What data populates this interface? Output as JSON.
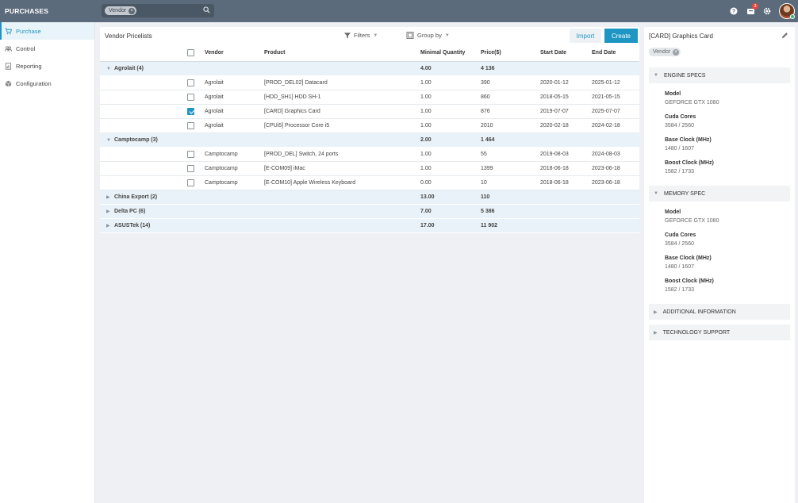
{
  "app": {
    "title": "PURCHASES"
  },
  "search": {
    "facet": "Vendor",
    "placeholder": ""
  },
  "header": {
    "notification_count": "3"
  },
  "sidebar": {
    "items": [
      {
        "label": "Purchase"
      },
      {
        "label": "Control"
      },
      {
        "label": "Reporting"
      },
      {
        "label": "Configuration"
      }
    ]
  },
  "main": {
    "title": "Vendor Pricelists",
    "filters_label": "Filters",
    "groupby_label": "Group by",
    "import_label": "Import",
    "create_label": "Create",
    "columns": [
      "Vendor",
      "Product",
      "Minimal Quantity",
      "Price($)",
      "Start Date",
      "End Date"
    ],
    "groups": [
      {
        "name": "Agrolait (4)",
        "qty": "4.00",
        "price": "4 136",
        "expanded": true,
        "rows": [
          {
            "vendor": "Agrolait",
            "product": "[PROD_DEL02] Datacard",
            "qty": "1.00",
            "price": "390",
            "start": "2020-01-12",
            "end": "2025-01-12",
            "checked": false
          },
          {
            "vendor": "Agrolait",
            "product": "[HDD_SH1] HDD SH-1",
            "qty": "1.00",
            "price": "860",
            "start": "2018-05-15",
            "end": "2021-05-15",
            "checked": false
          },
          {
            "vendor": "Agrolait",
            "product": "[CARD] Graphics Card",
            "qty": "1.00",
            "price": "876",
            "start": "2019-07-07",
            "end": "2025-07-07",
            "checked": true
          },
          {
            "vendor": "Agrolait",
            "product": "[CPUi5] Processor Core i5",
            "qty": "1.00",
            "price": "2010",
            "start": "2020-02-18",
            "end": "2024-02-18",
            "checked": false
          }
        ]
      },
      {
        "name": "Camptocamp (3)",
        "qty": "2.00",
        "price": "1 464",
        "expanded": true,
        "rows": [
          {
            "vendor": "Camptocamp",
            "product": "[PROD_DEL] Switch, 24 ports",
            "qty": "1.00",
            "price": "55",
            "start": "2019-08-03",
            "end": "2024-08-03",
            "checked": false
          },
          {
            "vendor": "Camptocamp",
            "product": "[E-COM09] iMac",
            "qty": "1.00",
            "price": "1399",
            "start": "2018-06-18",
            "end": "2023-06-18",
            "checked": false
          },
          {
            "vendor": "Camptocamp",
            "product": "[E-COM10] Apple Wireless Keyboard",
            "qty": "0.00",
            "price": "10",
            "start": "2018-06-18",
            "end": "2023-06-18",
            "checked": false
          }
        ]
      },
      {
        "name": "China Export (2)",
        "qty": "13.00",
        "price": "110",
        "expanded": false,
        "rows": []
      },
      {
        "name": "Delta PC (6)",
        "qty": "7.00",
        "price": "5 386",
        "expanded": false,
        "rows": []
      },
      {
        "name": "ASUSTek (14)",
        "qty": "17.00",
        "price": "11 902",
        "expanded": false,
        "rows": []
      }
    ]
  },
  "panel": {
    "title": "[CARD] Graphics Card",
    "facet": "Vendor",
    "sections": [
      {
        "title": "ENGINE SPECS",
        "expanded": true,
        "specs": [
          {
            "label": "Model",
            "value": "GEFORCE GTX 1080"
          },
          {
            "label": "Cuda Cores",
            "value": "3584 / 2560"
          },
          {
            "label": "Base Clock (MHz)",
            "value": "1480 / 1607"
          },
          {
            "label": "Boost Clock (MHz)",
            "value": "1582 / 1733"
          }
        ]
      },
      {
        "title": "MEMORY SPEC",
        "expanded": true,
        "specs": [
          {
            "label": "Model",
            "value": "GEFORCE GTX 1080"
          },
          {
            "label": "Cuda Cores",
            "value": "3584 / 2560"
          },
          {
            "label": "Base Clock (MHz)",
            "value": "1480 / 1607"
          },
          {
            "label": "Boost Clock (MHz)",
            "value": "1582 / 1733"
          }
        ]
      },
      {
        "title": "ADDITIONAL INFORMATION",
        "expanded": false,
        "specs": []
      },
      {
        "title": "TECHNOLOGY SUPPORT",
        "expanded": false,
        "specs": []
      }
    ]
  },
  "colors": {
    "accent": "#1f95c4",
    "topbar": "#5c6b7b",
    "group_row": "#e9f2f8"
  }
}
